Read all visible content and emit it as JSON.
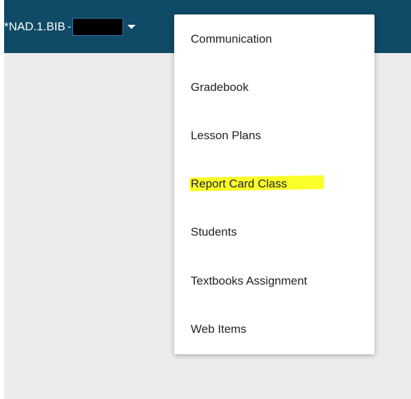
{
  "header": {
    "class_name": "*NAD.1.BIB",
    "separator": "-",
    "caret_icon": "chevron-down-icon"
  },
  "menu": {
    "items": [
      {
        "label": "Communication"
      },
      {
        "label": "Gradebook"
      },
      {
        "label": "Lesson Plans"
      },
      {
        "label": "Report Card Class",
        "highlighted": true
      },
      {
        "label": "Students"
      },
      {
        "label": "Textbooks Assignment"
      },
      {
        "label": "Web Items"
      }
    ]
  },
  "colors": {
    "topbar": "#0f4a66",
    "background": "#ececec",
    "highlight": "#fbff2a"
  }
}
